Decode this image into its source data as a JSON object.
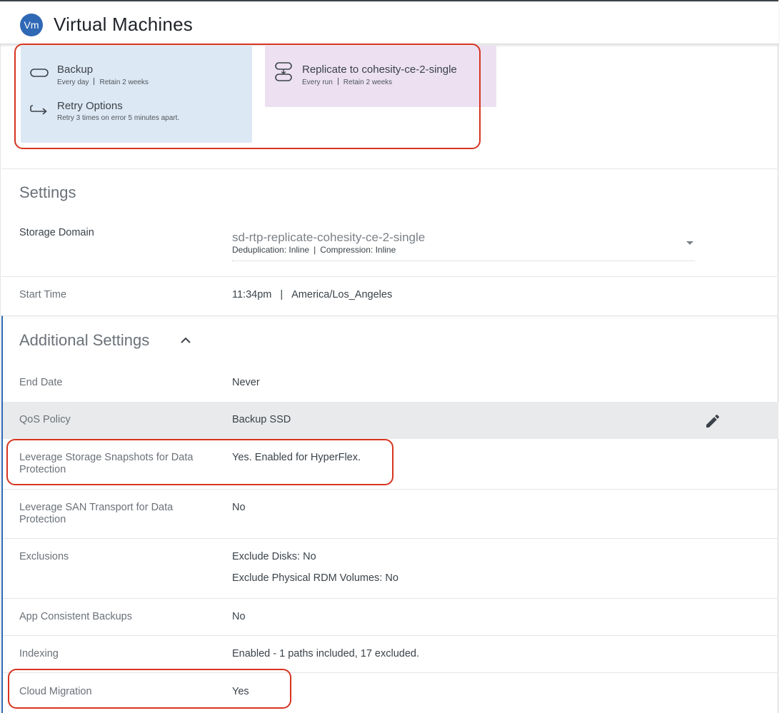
{
  "header": {
    "badge": "Vm",
    "title": "Virtual Machines"
  },
  "policy": {
    "backup": {
      "title": "Backup",
      "frequency": "Every day",
      "retention": "Retain 2 weeks"
    },
    "retry": {
      "title": "Retry Options",
      "detail": "Retry 3 times on error 5 minutes apart."
    },
    "replicate": {
      "title": "Replicate to cohesity-ce-2-single",
      "frequency": "Every run",
      "retention": "Retain 2 weeks"
    }
  },
  "settings": {
    "title": "Settings",
    "storage_domain": {
      "label": "Storage Domain",
      "name": "sd-rtp-replicate-cohesity-ce-2-single",
      "dedup": "Deduplication: Inline",
      "compression": "Compression: Inline"
    },
    "start_time": {
      "label": "Start Time",
      "time": "11:34pm",
      "timezone": "America/Los_Angeles"
    }
  },
  "additional": {
    "title": "Additional Settings",
    "end_date": {
      "label": "End Date",
      "value": "Never"
    },
    "qos": {
      "label": "QoS Policy",
      "value": "Backup SSD"
    },
    "storage_snapshots": {
      "label_line1": "Leverage Storage Snapshots for Data",
      "label_line2": "Protection",
      "value": "Yes. Enabled for HyperFlex."
    },
    "san_transport": {
      "label_line1": "Leverage SAN Transport for Data",
      "label_line2": "Protection",
      "value": "No"
    },
    "exclusions": {
      "label": "Exclusions",
      "disks": "Exclude Disks: No",
      "rdm": "Exclude Physical RDM Volumes: No"
    },
    "app_consistent": {
      "label": "App Consistent Backups",
      "value": "No"
    },
    "indexing": {
      "label": "Indexing",
      "value": "Enabled - 1 paths included, 17 excluded."
    },
    "cloud_migration": {
      "label": "Cloud Migration",
      "value": "Yes"
    }
  },
  "colors": {
    "accent": "#2f68b5",
    "highlight": "#d7341f",
    "backup_card": "#dce8f4",
    "replicate_card": "#ece0f1"
  }
}
